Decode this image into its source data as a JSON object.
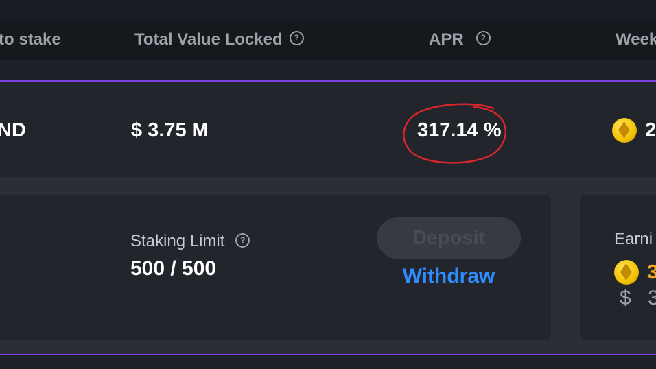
{
  "header": {
    "col_stake": "to stake",
    "col_tvl": "Total Value Locked",
    "col_apr": "APR",
    "col_weekly": "Week",
    "help_glyph": "?"
  },
  "pool": {
    "token_suffix": "ND",
    "tvl": "$ 3.75 M",
    "apr": "317.14 %",
    "weekly_partial": "2",
    "coin_icon": "gold-coin-icon"
  },
  "details": {
    "staking_limit_label": "Staking Limit",
    "staking_limit_value": "500 / 500",
    "deposit_label": "Deposit",
    "withdraw_label": "Withdraw",
    "earnings_label": "Earni",
    "earnings_token_partial": "3",
    "earnings_usd_prefix": "$",
    "earnings_usd_partial": "3"
  },
  "colors": {
    "accent_purple": "#7b3fe4",
    "link_blue": "#2f8cff",
    "earnings_orange": "#f5a623",
    "annotation_red": "#d8262c"
  }
}
